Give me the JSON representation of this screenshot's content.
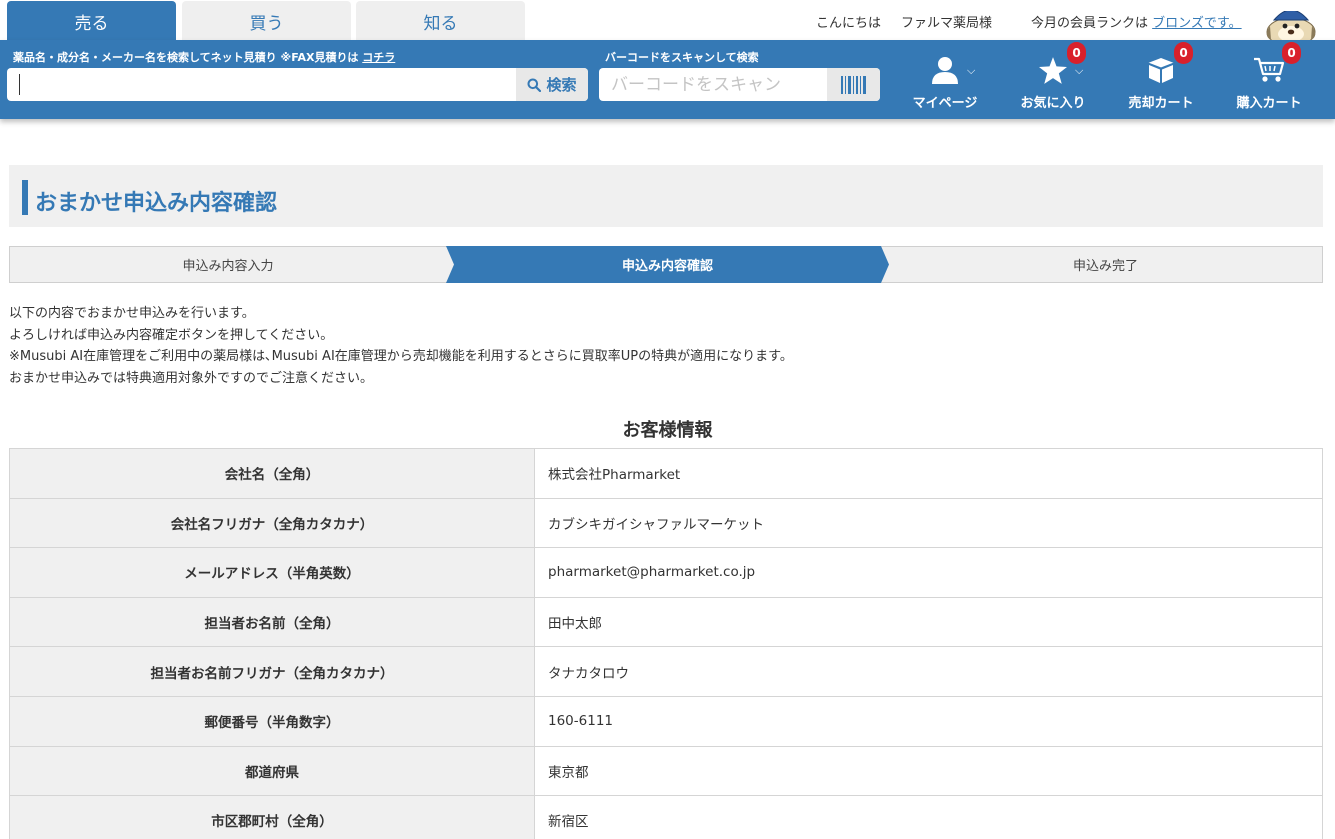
{
  "tabs": [
    {
      "label": "売る",
      "active": true
    },
    {
      "label": "買う",
      "active": false
    },
    {
      "label": "知る",
      "active": false
    }
  ],
  "greeting": {
    "hello": "こんにちは",
    "pharmacy": "ファルマ薬局様",
    "rank_prefix": "今月の会員ランクは",
    "rank_link": "ブロンズです。"
  },
  "search": {
    "label": "薬品名・成分名・メーカー名を検索してネット見積り ※FAX見積りは",
    "fax_link": "コチラ",
    "value": "",
    "button": "検索"
  },
  "barcode": {
    "label": "バーコードをスキャンして検索",
    "placeholder": "バーコードをスキャン"
  },
  "nav": {
    "mypage": "マイページ",
    "favorites": "お気に入り",
    "favorites_count": "0",
    "sell_cart": "売却カート",
    "sell_cart_count": "0",
    "buy_cart": "購入カート",
    "buy_cart_count": "0"
  },
  "page_title": "おまかせ申込み内容確認",
  "steps": [
    {
      "label": "申込み内容入力",
      "active": false
    },
    {
      "label": "申込み内容確認",
      "active": true
    },
    {
      "label": "申込み完了",
      "active": false
    }
  ],
  "notes": [
    "以下の内容でおまかせ申込みを行います。",
    "よろしければ申込み内容確定ボタンを押してください。",
    "※Musubi AI在庫管理をご利用中の薬局様は､Musubi AI在庫管理から売却機能を利用するとさらに買取率UPの特典が適用になります。",
    "おまかせ申込みでは特典適用対象外ですのでご注意ください。"
  ],
  "section_title": "お客様情報",
  "customer_rows": [
    {
      "label": "会社名（全角）",
      "value": "株式会社Pharmarket"
    },
    {
      "label": "会社名フリガナ（全角カタカナ）",
      "value": "カブシキガイシャファルマーケット"
    },
    {
      "label": "メールアドレス（半角英数）",
      "value": "pharmarket@pharmarket.co.jp"
    },
    {
      "label": "担当者お名前（全角）",
      "value": "田中太郎"
    },
    {
      "label": "担当者お名前フリガナ（全角カタカナ）",
      "value": "タナカタロウ"
    },
    {
      "label": "郵便番号（半角数字）",
      "value": "160-6111"
    },
    {
      "label": "都道府県",
      "value": "東京都"
    },
    {
      "label": "市区郡町村（全角）",
      "value": "新宿区"
    }
  ],
  "colors": {
    "brand_blue": "#3579b5",
    "badge_red": "#d9202b",
    "panel_gray": "#f0f0f0"
  }
}
